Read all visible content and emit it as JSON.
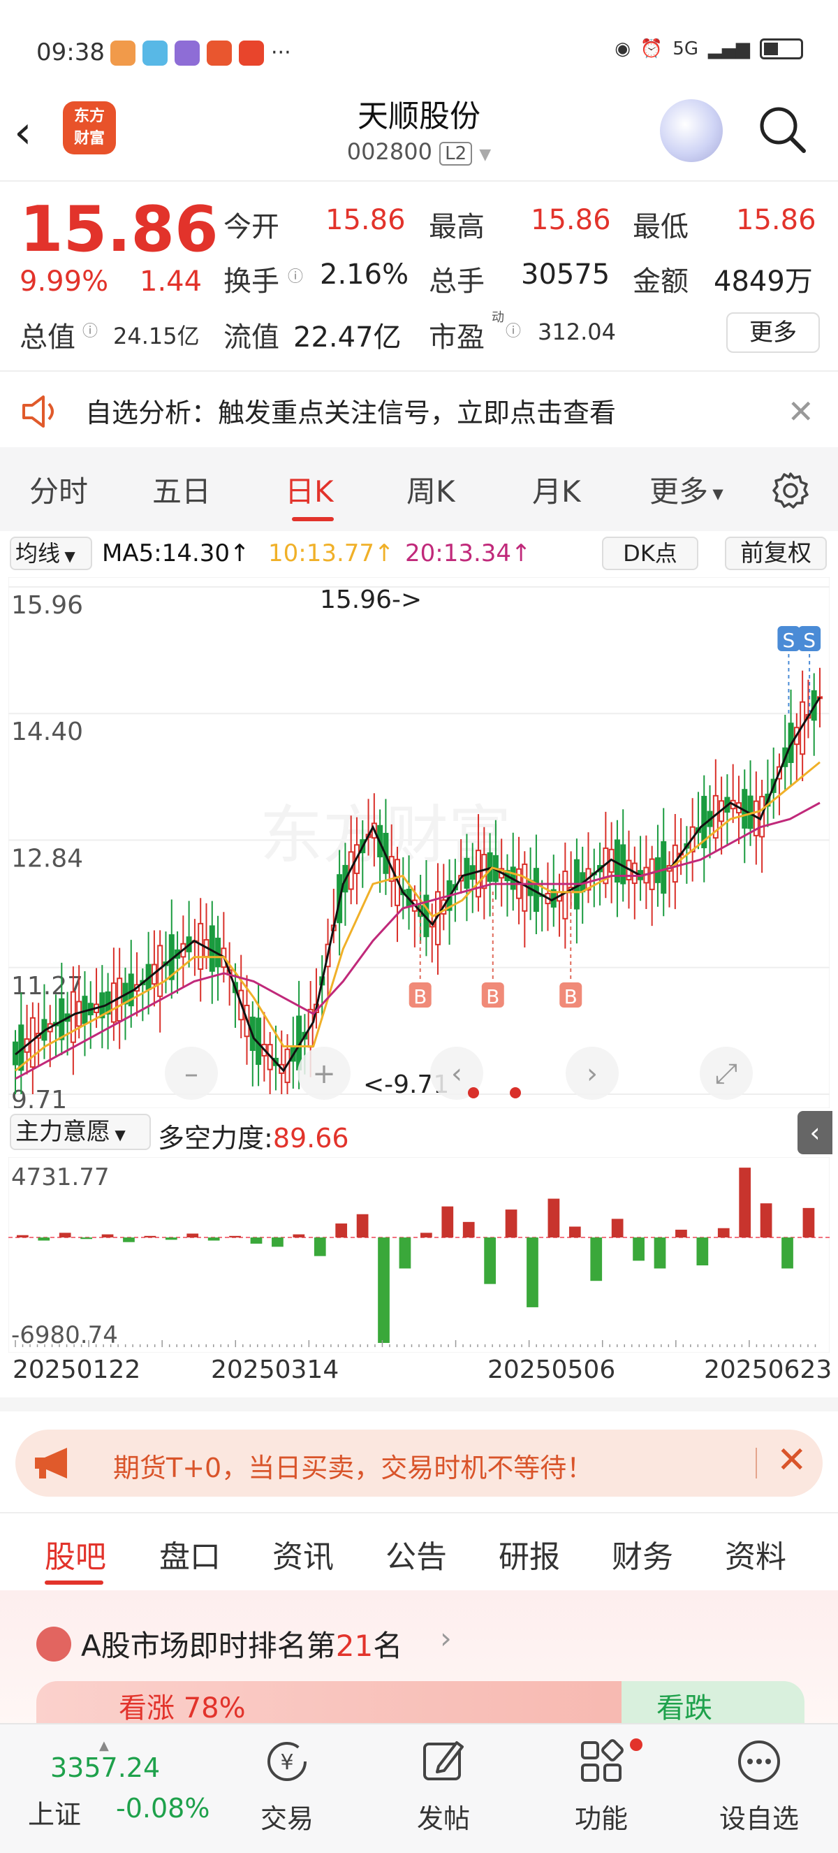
{
  "status": {
    "time": "09:38",
    "dots": "···",
    "signal": "5G"
  },
  "header": {
    "back": "‹",
    "logo": "东方\n财富",
    "title": "天顺股份",
    "code": "002800",
    "l2": "L2"
  },
  "quote": {
    "price": "15.86",
    "pct": "9.99%",
    "change": "1.44",
    "open_label": "今开",
    "open": "15.86",
    "high_label": "最高",
    "high": "15.86",
    "low_label": "最低",
    "low": "15.86",
    "turnover_label": "换手",
    "turnover": "2.16%",
    "volume_label": "总手",
    "volume": "30575",
    "amount_label": "金额",
    "amount": "4849万",
    "mcap_label": "总值",
    "mcap": "24.15亿",
    "float_label": "流值",
    "float": "22.47亿",
    "pe_label": "市盈",
    "pe_sup": "动",
    "pe": "312.04",
    "more": "更多"
  },
  "analysis": {
    "text": "自选分析：触发重点关注信号，立即点击查看"
  },
  "tabs": [
    "分时",
    "五日",
    "日K",
    "周K",
    "月K",
    "更多"
  ],
  "active_tab": "日K",
  "ma": {
    "selector": "均线",
    "ma5": "MA5:14.30↑",
    "ma10": "10:13.77↑",
    "ma20": "20:13.34↑",
    "dk": "DK点",
    "adjust": "前复权",
    "ma5_color": "#111111",
    "ma10_color": "#f0b028",
    "ma20_color": "#c0297a"
  },
  "chart_data": [
    {
      "type": "candlestick",
      "title": "",
      "ylim": [
        9.71,
        15.96
      ],
      "y_ticks": [
        "15.96",
        "14.40",
        "12.84",
        "11.27",
        "9.71"
      ],
      "max_label": "15.96->",
      "min_label": "<-9.71",
      "markers": [
        {
          "label": "B",
          "date": "2025-04-10"
        },
        {
          "label": "B",
          "date": "2025-04-24"
        },
        {
          "label": "B",
          "date": "2025-05-09"
        },
        {
          "label": "S",
          "date": "2025-06-20"
        },
        {
          "label": "S",
          "date": "2025-06-24"
        }
      ],
      "series": [
        {
          "name": "MA5",
          "values": [
            10.2,
            10.5,
            10.7,
            10.8,
            11.0,
            11.3,
            11.6,
            11.4,
            10.4,
            10.0,
            10.6,
            12.3,
            13.0,
            12.2,
            11.8,
            12.4,
            12.5,
            12.3,
            12.1,
            12.3,
            12.6,
            12.4,
            12.5,
            13.0,
            13.3,
            13.1,
            14.0,
            14.6
          ]
        },
        {
          "name": "MA10",
          "values": [
            10.0,
            10.3,
            10.5,
            10.7,
            10.9,
            11.1,
            11.4,
            11.4,
            10.9,
            10.3,
            10.3,
            11.5,
            12.3,
            12.4,
            11.9,
            12.1,
            12.5,
            12.4,
            12.2,
            12.2,
            12.4,
            12.4,
            12.5,
            12.8,
            13.1,
            13.2,
            13.5,
            13.8
          ]
        },
        {
          "name": "MA20",
          "values": [
            9.9,
            10.1,
            10.3,
            10.5,
            10.7,
            10.9,
            11.1,
            11.2,
            11.1,
            10.9,
            10.7,
            11.1,
            11.6,
            12.0,
            12.1,
            12.2,
            12.3,
            12.3,
            12.3,
            12.3,
            12.4,
            12.4,
            12.5,
            12.6,
            12.8,
            13.0,
            13.1,
            13.3
          ]
        }
      ]
    },
    {
      "type": "bar",
      "title": "",
      "ylim": [
        -6980.74,
        4731.77
      ],
      "y_ticks": [
        "4731.77",
        "-6980.74"
      ],
      "values": [
        150,
        -200,
        300,
        -100,
        200,
        -300,
        100,
        -150,
        250,
        -200,
        100,
        -400,
        -600,
        200,
        -1200,
        900,
        1500,
        -6800,
        -2000,
        300,
        2000,
        1000,
        -3000,
        1800,
        -4500,
        2500,
        700,
        -2800,
        1200,
        -1500,
        -2000,
        500,
        -1800,
        600,
        4500,
        2200,
        -2000,
        1900
      ]
    }
  ],
  "indicator": {
    "selector": "主力意愿",
    "label": "多空力度:",
    "value": "89.66"
  },
  "dates": [
    "20250122",
    "20250314",
    "20250506",
    "20250623"
  ],
  "promo": {
    "text": "期货T+0，当日买卖，交易时机不等待！"
  },
  "bottom_tabs": [
    "股吧",
    "盘口",
    "资讯",
    "公告",
    "研报",
    "财务",
    "资料"
  ],
  "rank": {
    "prefix": "A股市场即时排名第",
    "num": "21",
    "suffix": "名",
    "up": "看涨 78%",
    "down": "看跌"
  },
  "nav": {
    "index_value": "3357.24",
    "index_name": "上证",
    "index_change": "-0.08%",
    "items": [
      "交易",
      "发帖",
      "功能",
      "设自选"
    ]
  }
}
